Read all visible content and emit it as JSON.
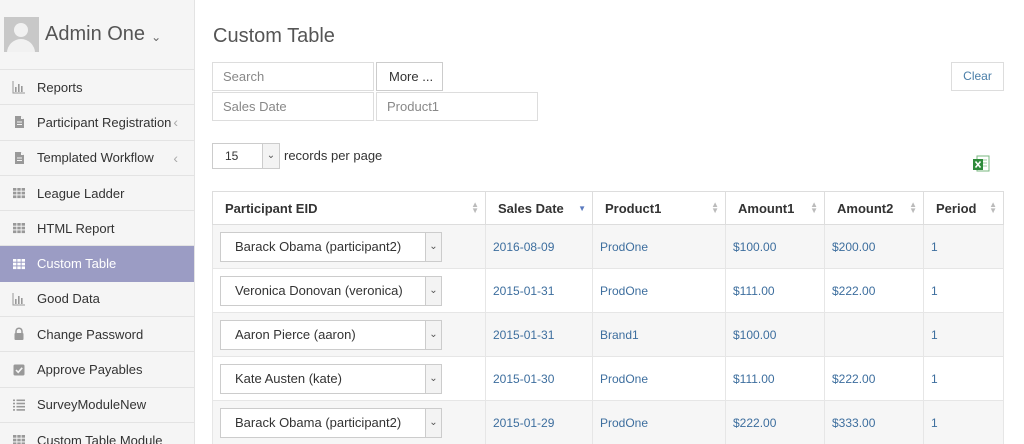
{
  "profile": {
    "name": "Admin One",
    "caret": "⌄"
  },
  "sidebar": {
    "items": [
      {
        "label": "Reports",
        "icon": "bar-chart-icon",
        "active": false,
        "has_chevron": false
      },
      {
        "label": "Participant Registration",
        "icon": "document-icon",
        "active": false,
        "has_chevron": true
      },
      {
        "label": "Templated Workflow",
        "icon": "document-icon",
        "active": false,
        "has_chevron": true
      },
      {
        "label": "League Ladder",
        "icon": "grid-icon",
        "active": false,
        "has_chevron": false
      },
      {
        "label": "HTML Report",
        "icon": "grid-icon",
        "active": false,
        "has_chevron": false
      },
      {
        "label": "Custom Table",
        "icon": "grid-icon",
        "active": true,
        "has_chevron": false
      },
      {
        "label": "Good Data",
        "icon": "bar-chart-icon",
        "active": false,
        "has_chevron": false
      },
      {
        "label": "Change Password",
        "icon": "lock-icon",
        "active": false,
        "has_chevron": false
      },
      {
        "label": "Approve Payables",
        "icon": "checkbox-icon",
        "active": false,
        "has_chevron": false
      },
      {
        "label": "SurveyModuleNew",
        "icon": "list-icon",
        "active": false,
        "has_chevron": false
      },
      {
        "label": "Custom Table Module",
        "icon": "grid-icon",
        "active": false,
        "has_chevron": false
      }
    ],
    "chevron": "‹"
  },
  "main": {
    "title": "Custom Table",
    "filters": {
      "search_placeholder": "Search",
      "more_label": "More ...",
      "sales_date_placeholder": "Sales Date",
      "product1_placeholder": "Product1",
      "clear_label": "Clear"
    },
    "pagination": {
      "per_page_value": "15",
      "per_page_label": "records per page"
    },
    "table": {
      "columns": [
        "Participant EID",
        "Sales Date",
        "Product1",
        "Amount1",
        "Amount2",
        "Period"
      ],
      "sorted_column": "Sales Date",
      "rows": [
        {
          "participant": "Barack Obama (participant2)",
          "sales_date": "2016-08-09",
          "product1": "ProdOne",
          "amount1": "$100.00",
          "amount2": "$200.00",
          "period": "1"
        },
        {
          "participant": "Veronica Donovan (veronica)",
          "sales_date": "2015-01-31",
          "product1": "ProdOne",
          "amount1": "$111.00",
          "amount2": "$222.00",
          "period": "1"
        },
        {
          "participant": "Aaron Pierce (aaron)",
          "sales_date": "2015-01-31",
          "product1": "Brand1",
          "amount1": "$100.00",
          "amount2": "",
          "period": "1"
        },
        {
          "participant": "Kate Austen (kate)",
          "sales_date": "2015-01-30",
          "product1": "ProdOne",
          "amount1": "$111.00",
          "amount2": "$222.00",
          "period": "1"
        },
        {
          "participant": "Barack Obama (participant2)",
          "sales_date": "2015-01-29",
          "product1": "ProdOne",
          "amount1": "$222.00",
          "amount2": "$333.00",
          "period": "1"
        }
      ]
    }
  },
  "colors": {
    "active_nav": "#9b9cc4",
    "link": "#3d6e9e",
    "excel_green": "#2e8b3a"
  }
}
